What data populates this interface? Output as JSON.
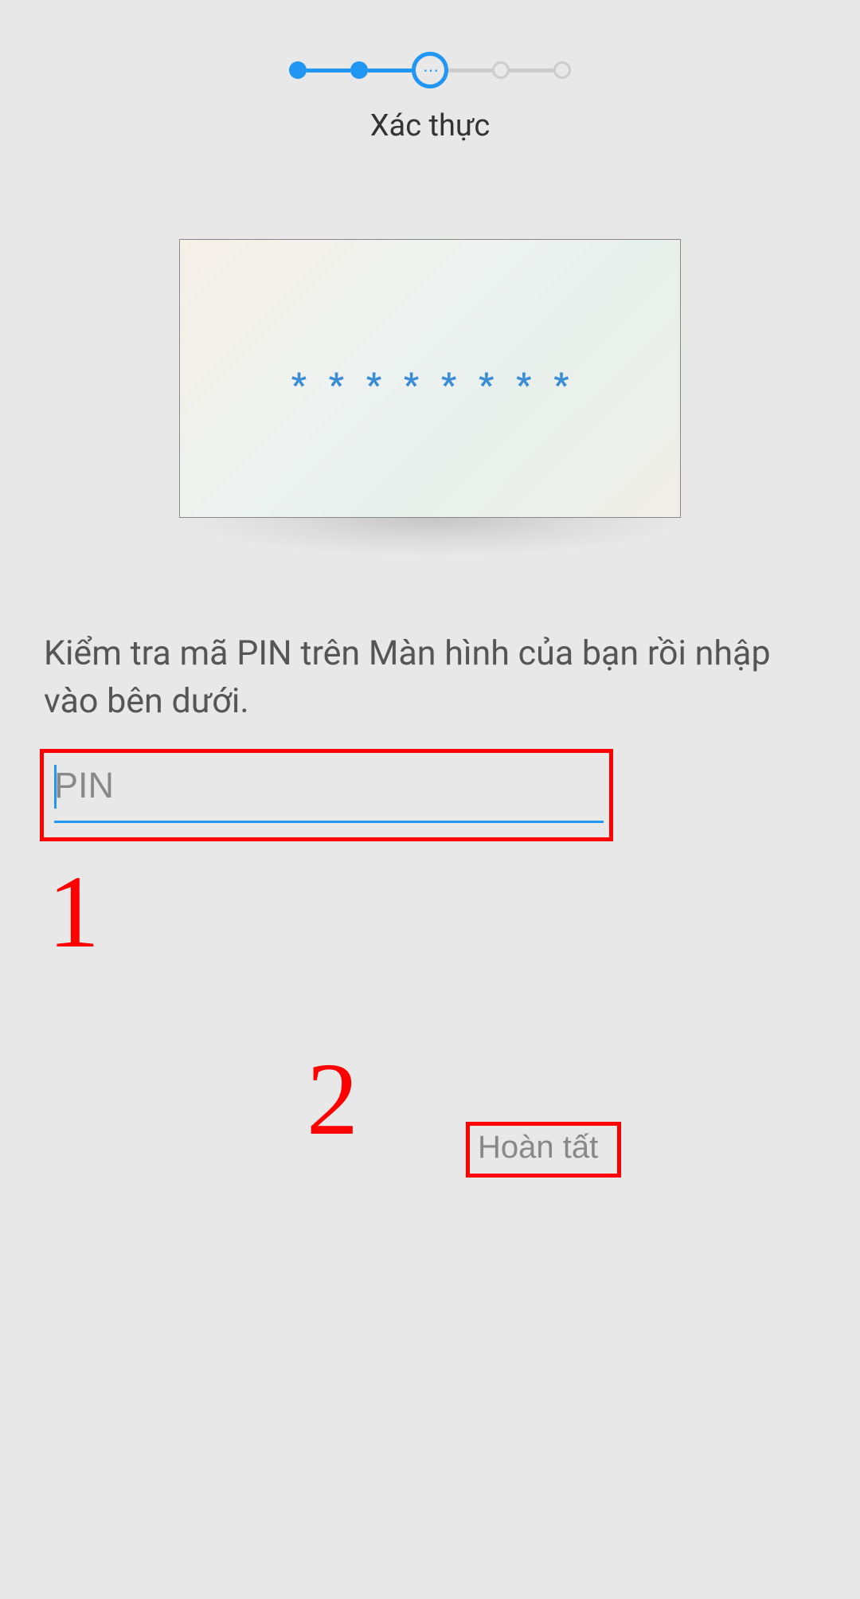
{
  "stepper": {
    "label": "Xác thực",
    "steps": [
      {
        "state": "completed"
      },
      {
        "state": "completed"
      },
      {
        "state": "current"
      },
      {
        "state": "pending"
      },
      {
        "state": "pending"
      }
    ]
  },
  "tv": {
    "asterisks": [
      "*",
      "*",
      "*",
      "*",
      "*",
      "*",
      "*",
      "*"
    ]
  },
  "instruction": "Kiểm tra mã PIN trên Màn hình của bạn rồi nhập vào bên dưới.",
  "pin_input": {
    "placeholder": "PIN",
    "value": ""
  },
  "annotations": {
    "label_1": "1",
    "label_2": "2"
  },
  "done_button": {
    "label": "Hoàn tất"
  }
}
